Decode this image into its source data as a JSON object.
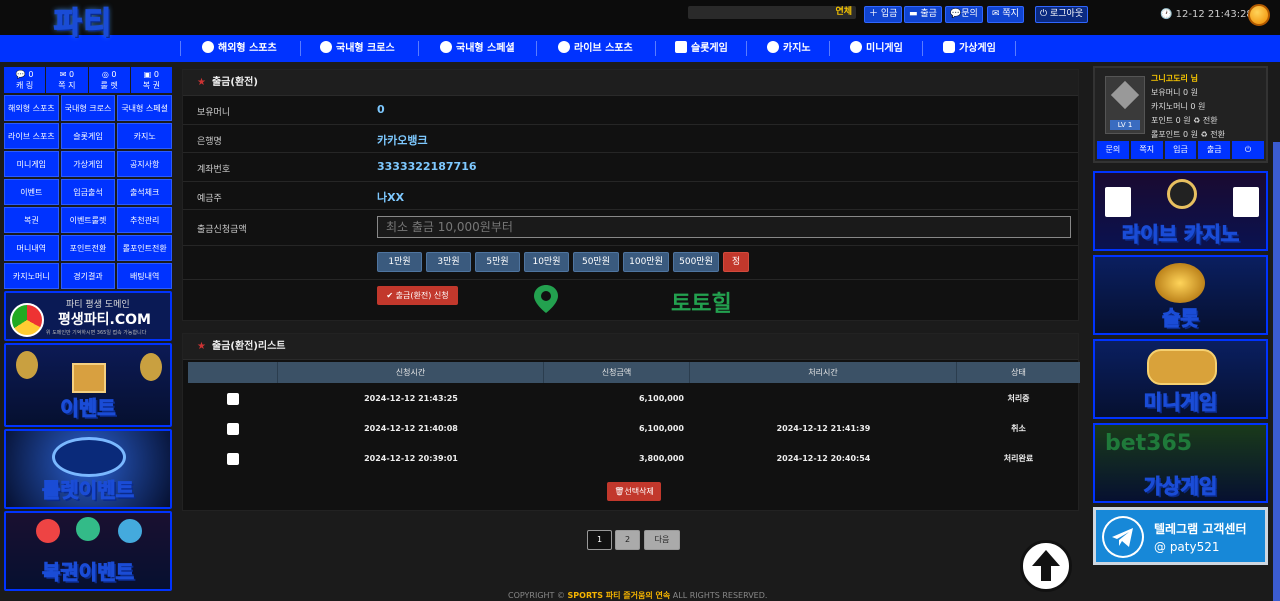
{
  "header": {
    "logo_text": "파티",
    "ticker": "연체",
    "buttons": [
      "입금",
      "출금",
      "문의",
      "쪽지"
    ],
    "logout": "로그아웃",
    "clock": "12-12 21:43:28"
  },
  "nav": [
    "해외형 스포츠",
    "국내형 크로스",
    "국내형 스페셜",
    "라이브 스포츠",
    "슬롯게임",
    "카지노",
    "미니게임",
    "가상게임"
  ],
  "left": {
    "quick": [
      {
        "count": "0",
        "label": "캐 링"
      },
      {
        "count": "0",
        "label": "쪽 지"
      },
      {
        "count": "0",
        "label": "룰 렛"
      },
      {
        "count": "0",
        "label": "복 권"
      }
    ],
    "menu": [
      "해외형 스포츠",
      "국내형 크로스",
      "국내형 스페셜",
      "라이브 스포츠",
      "슬롯게임",
      "카지노",
      "미니게임",
      "가상게임",
      "공지사항",
      "이벤트",
      "입금출석",
      "출석체크",
      "복권",
      "이벤트룰렛",
      "추천관리",
      "머니내역",
      "포인트전환",
      "롤포인트전환",
      "카지노머니",
      "경기결과",
      "배팅내역"
    ],
    "banners": [
      {
        "top": "파티 평생 도메인",
        "main": "평생파티.COM",
        "sub": "위 도메인만 기억하시면 365일 접속 가능합니다"
      },
      {
        "main": "이벤트"
      },
      {
        "main": "룰렛이벤트"
      },
      {
        "main": "복권이벤트"
      }
    ]
  },
  "withdraw_form": {
    "title": "출금(환전)",
    "fields": [
      {
        "label": "보유머니",
        "value": "0"
      },
      {
        "label": "은행명",
        "value": "카카오뱅크"
      },
      {
        "label": "계좌번호",
        "value": "3333322187716"
      },
      {
        "label": "예금주",
        "value": "나XX"
      }
    ],
    "amount_label": "출금신청금액",
    "amount_placeholder": "최소 출금 10,000원부터",
    "amount_buttons": [
      "1만원",
      "3만원",
      "5만원",
      "10만원",
      "50만원",
      "100만원",
      "500만원"
    ],
    "reset_button": "정",
    "submit_button": "출금(환전) 신청",
    "watermark": "토토힐"
  },
  "withdraw_list": {
    "title": "출금(환전)리스트",
    "columns": [
      "",
      "신청시간",
      "신청금액",
      "처리시간",
      "상태"
    ],
    "rows": [
      {
        "requested": "2024-12-12 21:43:25",
        "amount": "6,100,000",
        "processed": "",
        "status": "처리중"
      },
      {
        "requested": "2024-12-12 21:40:08",
        "amount": "6,100,000",
        "processed": "2024-12-12 21:41:39",
        "status": "취소"
      },
      {
        "requested": "2024-12-12 20:39:01",
        "amount": "3,800,000",
        "processed": "2024-12-12 20:40:54",
        "status": "처리완료"
      }
    ],
    "delete_button": "선택삭제"
  },
  "pagination": {
    "pages": [
      "1",
      "2"
    ],
    "next": "다음",
    "current": "1"
  },
  "footer": {
    "prefix": "COPYRIGHT ©",
    "brand": "SPORTS 파티 즐거움의 연속",
    "suffix": "ALL RIGHTS RESERVED."
  },
  "user": {
    "name": "그니고도리 님",
    "level_badge": "LV 1",
    "rows": [
      "보유머니 0 원",
      "카지노머니 0 원",
      "포인트 0 원 ♻ 전환",
      "롤포인트 0 원 ♻ 전환"
    ],
    "actions": [
      "문의",
      "쪽지",
      "입금",
      "출금",
      "⏻"
    ]
  },
  "right_banners": [
    "라이브 카지노",
    "슬롯",
    "미니게임",
    "가상게임"
  ],
  "telegram": {
    "title": "텔레그램 고객센터",
    "handle": "@ paty521"
  }
}
